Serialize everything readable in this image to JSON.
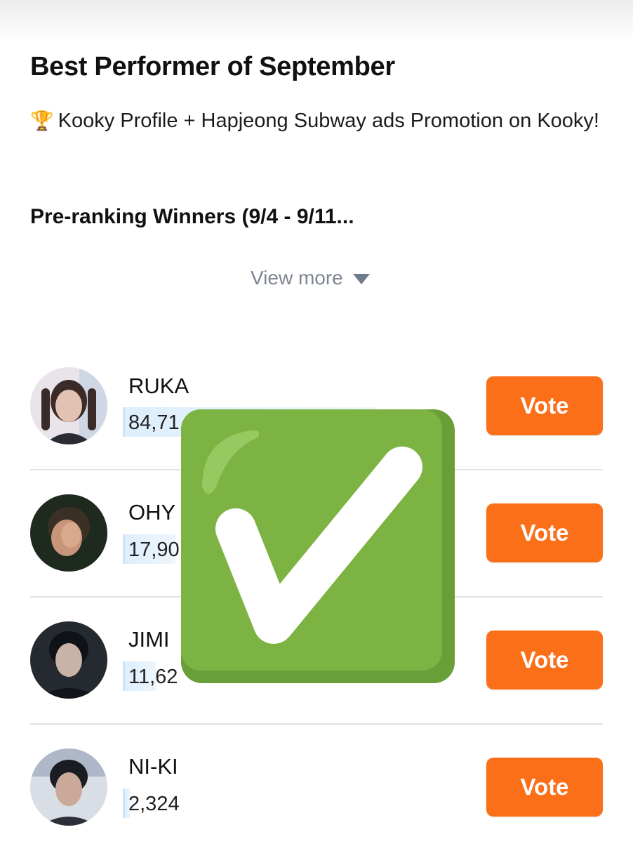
{
  "header": {
    "title": "Best Performer of September",
    "description": "Kooky Profile + Hapjeong Subway ads Promotion on Kooky!",
    "trophy_icon": "🏆",
    "subtitle": "Pre-ranking Winners (9/4 - 9/11...",
    "view_more_label": "View more"
  },
  "ranking": [
    {
      "name": "RUKA",
      "votes": "84,71",
      "share": 1.0,
      "avatar_colors": [
        "#c9a99b",
        "#3a2a28",
        "#e9e3ea"
      ]
    },
    {
      "name": "OHY",
      "votes": "17,90",
      "share": 0.21,
      "avatar_colors": [
        "#1f2a1f",
        "#c8957a",
        "#3b3026"
      ]
    },
    {
      "name": "JIMI",
      "votes": "11,62",
      "share": 0.14,
      "avatar_colors": [
        "#252a30",
        "#c9b3a6",
        "#0f1216"
      ]
    },
    {
      "name": "NI-KI",
      "votes": "2,324",
      "share": 0.03,
      "avatar_colors": [
        "#d9dde6",
        "#caa99a",
        "#1b1b22"
      ]
    }
  ],
  "vote_label": "Vote",
  "overlay": {
    "icon": "check-mark-button-icon"
  },
  "colors": {
    "vote_button": "#fb6f19",
    "bar": "#ddeefc",
    "check_green": "#7cb342",
    "view_more": "#7d8590"
  }
}
